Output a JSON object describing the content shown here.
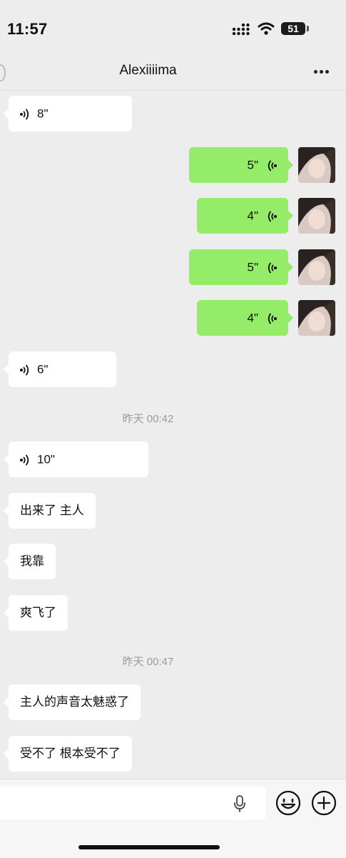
{
  "status_bar": {
    "time": "11:57",
    "battery_level": "51"
  },
  "header": {
    "title": "Alexiiiima"
  },
  "messages": [
    {
      "side": "left",
      "kind": "voice",
      "duration": "8\""
    },
    {
      "side": "right",
      "kind": "voice",
      "duration": "5\""
    },
    {
      "side": "right",
      "kind": "voice",
      "duration": "4\""
    },
    {
      "side": "right",
      "kind": "voice",
      "duration": "5\""
    },
    {
      "side": "right",
      "kind": "voice",
      "duration": "4\""
    },
    {
      "side": "left",
      "kind": "voice",
      "duration": "6\""
    },
    {
      "kind": "timestamp",
      "text": "昨天 00:42"
    },
    {
      "side": "left",
      "kind": "voice",
      "duration": "10\""
    },
    {
      "side": "left",
      "kind": "text",
      "text": "出来了 主人"
    },
    {
      "side": "left",
      "kind": "text",
      "text": "我靠"
    },
    {
      "side": "left",
      "kind": "text",
      "text": "爽飞了"
    },
    {
      "kind": "timestamp",
      "text": "昨天 00:47"
    },
    {
      "side": "left",
      "kind": "text",
      "text": "主人的声音太魅惑了"
    },
    {
      "side": "left",
      "kind": "text",
      "text": "受不了 根本受不了"
    }
  ],
  "icons": {
    "more": "more-icon",
    "voice": "voice-icon",
    "mic": "microphone-icon",
    "emoji": "emoji-icon",
    "plus": "plus-icon",
    "wifi": "wifi-icon",
    "signal": "signal-icon"
  },
  "colors": {
    "background": "#ededed",
    "incoming_bubble": "#ffffff",
    "outgoing_bubble": "#95ec69",
    "timestamp_text": "#9a9a9a"
  }
}
